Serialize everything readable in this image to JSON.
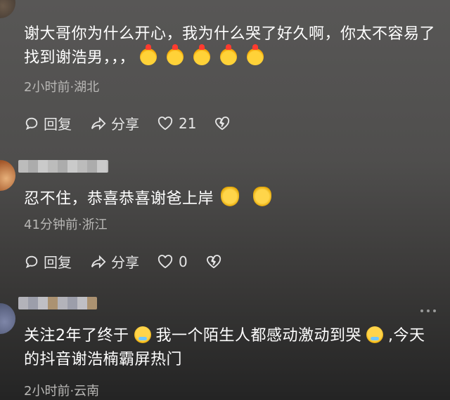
{
  "comments": [
    {
      "text_parts": [
        "谢大哥你为什么开心，我为什么哭了好久啊，你太不容易了找到谢浩男，，，"
      ],
      "emojis": [
        "chick-emoji",
        "chick-emoji",
        "chick-emoji",
        "chick-emoji",
        "chick-emoji"
      ],
      "meta": "2小时前·湖北",
      "actions": {
        "reply": "回复",
        "share": "分享",
        "likes": "21"
      }
    },
    {
      "text_parts": [
        "忍不住，恭喜恭喜谢爸上岸"
      ],
      "emojis": [
        "clap-emoji",
        "clap-emoji"
      ],
      "meta": "41分钟前·浙江",
      "actions": {
        "reply": "回复",
        "share": "分享",
        "likes": "0"
      }
    },
    {
      "text_parts": [
        "关注2年了终于",
        "我一个陌生人都感动激动到哭",
        ",今天的抖音谢浩楠霸屏热门"
      ],
      "emojis": [
        "cry-emoji",
        "sob-emoji"
      ],
      "meta": "2小时前·云南"
    }
  ],
  "icons": [
    "reply-icon",
    "share-icon",
    "heart-icon",
    "dislike-icon",
    "more-icon"
  ],
  "colors": {
    "text": "#ffffff",
    "meta": "#b8b7b5",
    "background": "#4f4e4d"
  }
}
